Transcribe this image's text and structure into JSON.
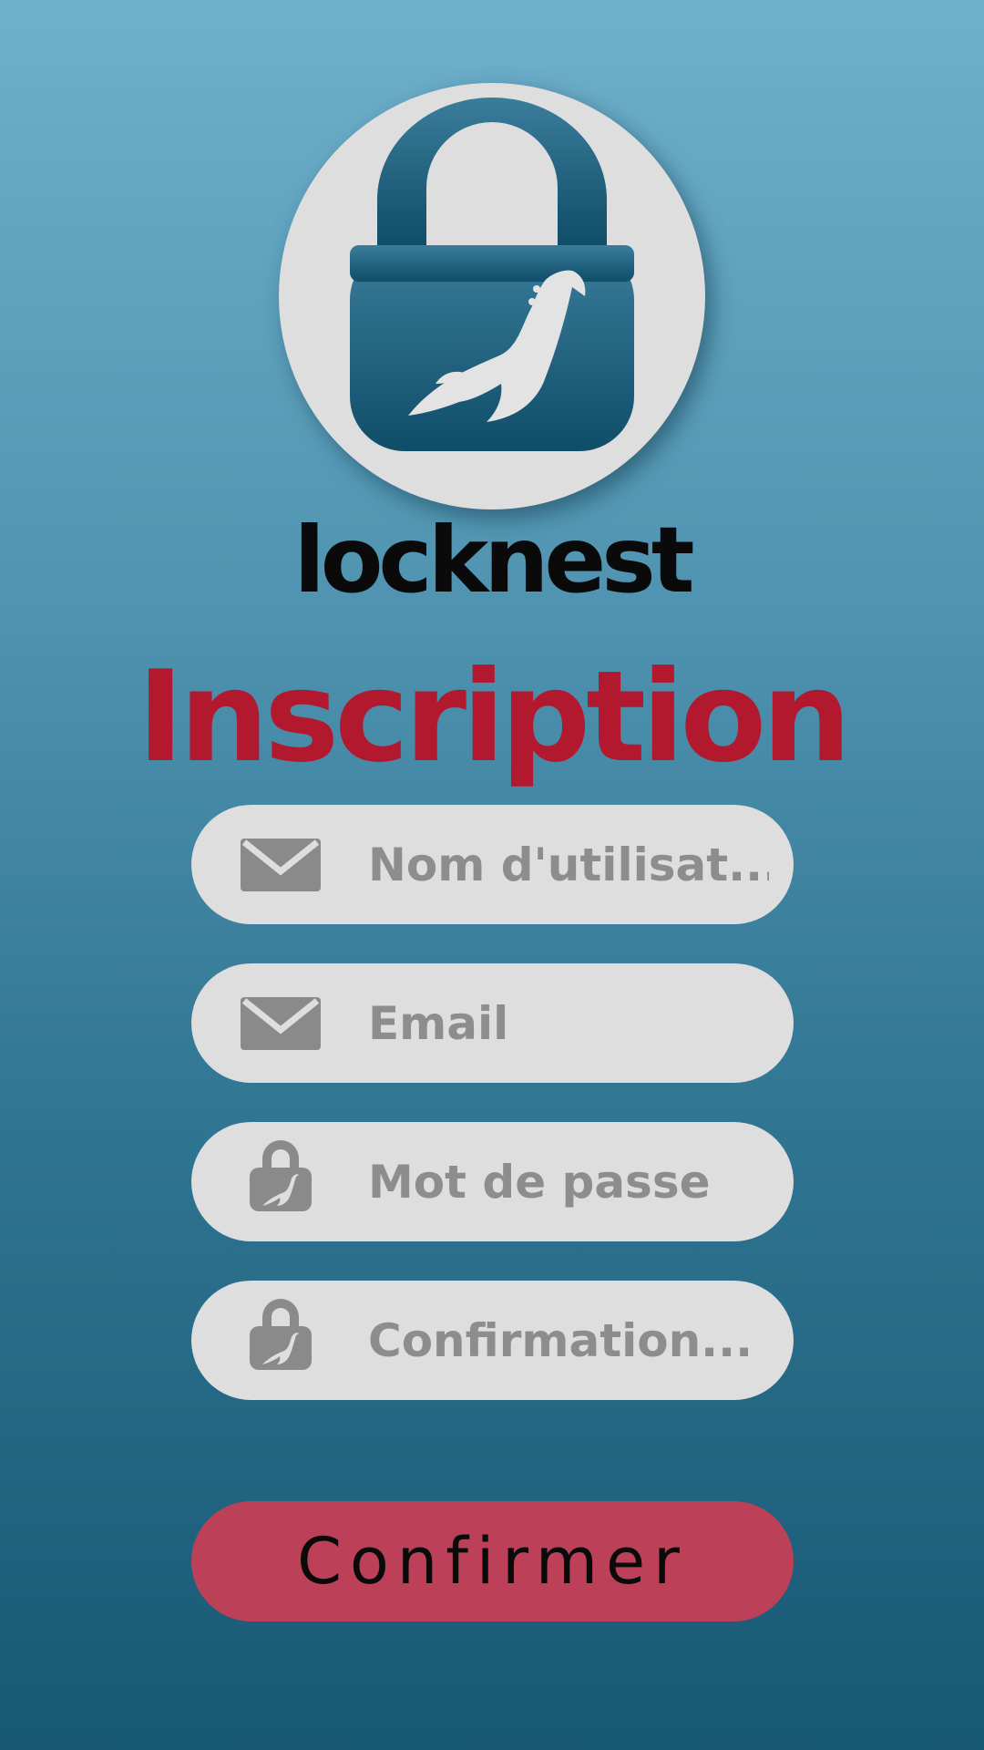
{
  "app": {
    "logo_icon": "padlock-nessie-icon",
    "brand_name": "locknest"
  },
  "form": {
    "title": "Inscription",
    "fields": [
      {
        "icon": "envelope-icon",
        "placeholder": "Nom d'utilisat...",
        "value": ""
      },
      {
        "icon": "envelope-icon",
        "placeholder": "Email",
        "value": ""
      },
      {
        "icon": "padlock-icon",
        "placeholder": "Mot de passe",
        "value": ""
      },
      {
        "icon": "padlock-icon",
        "placeholder": "Confirmation...",
        "value": ""
      }
    ],
    "submit_label": "Confirmer"
  },
  "colors": {
    "background_top": "#6fb0cb",
    "background_bottom": "#175874",
    "title": "#b2192f",
    "field_bg": "#dedede",
    "field_text": "#8d8d8d",
    "button_bg": "#bc4158",
    "logo_lock": "#1e607c"
  }
}
